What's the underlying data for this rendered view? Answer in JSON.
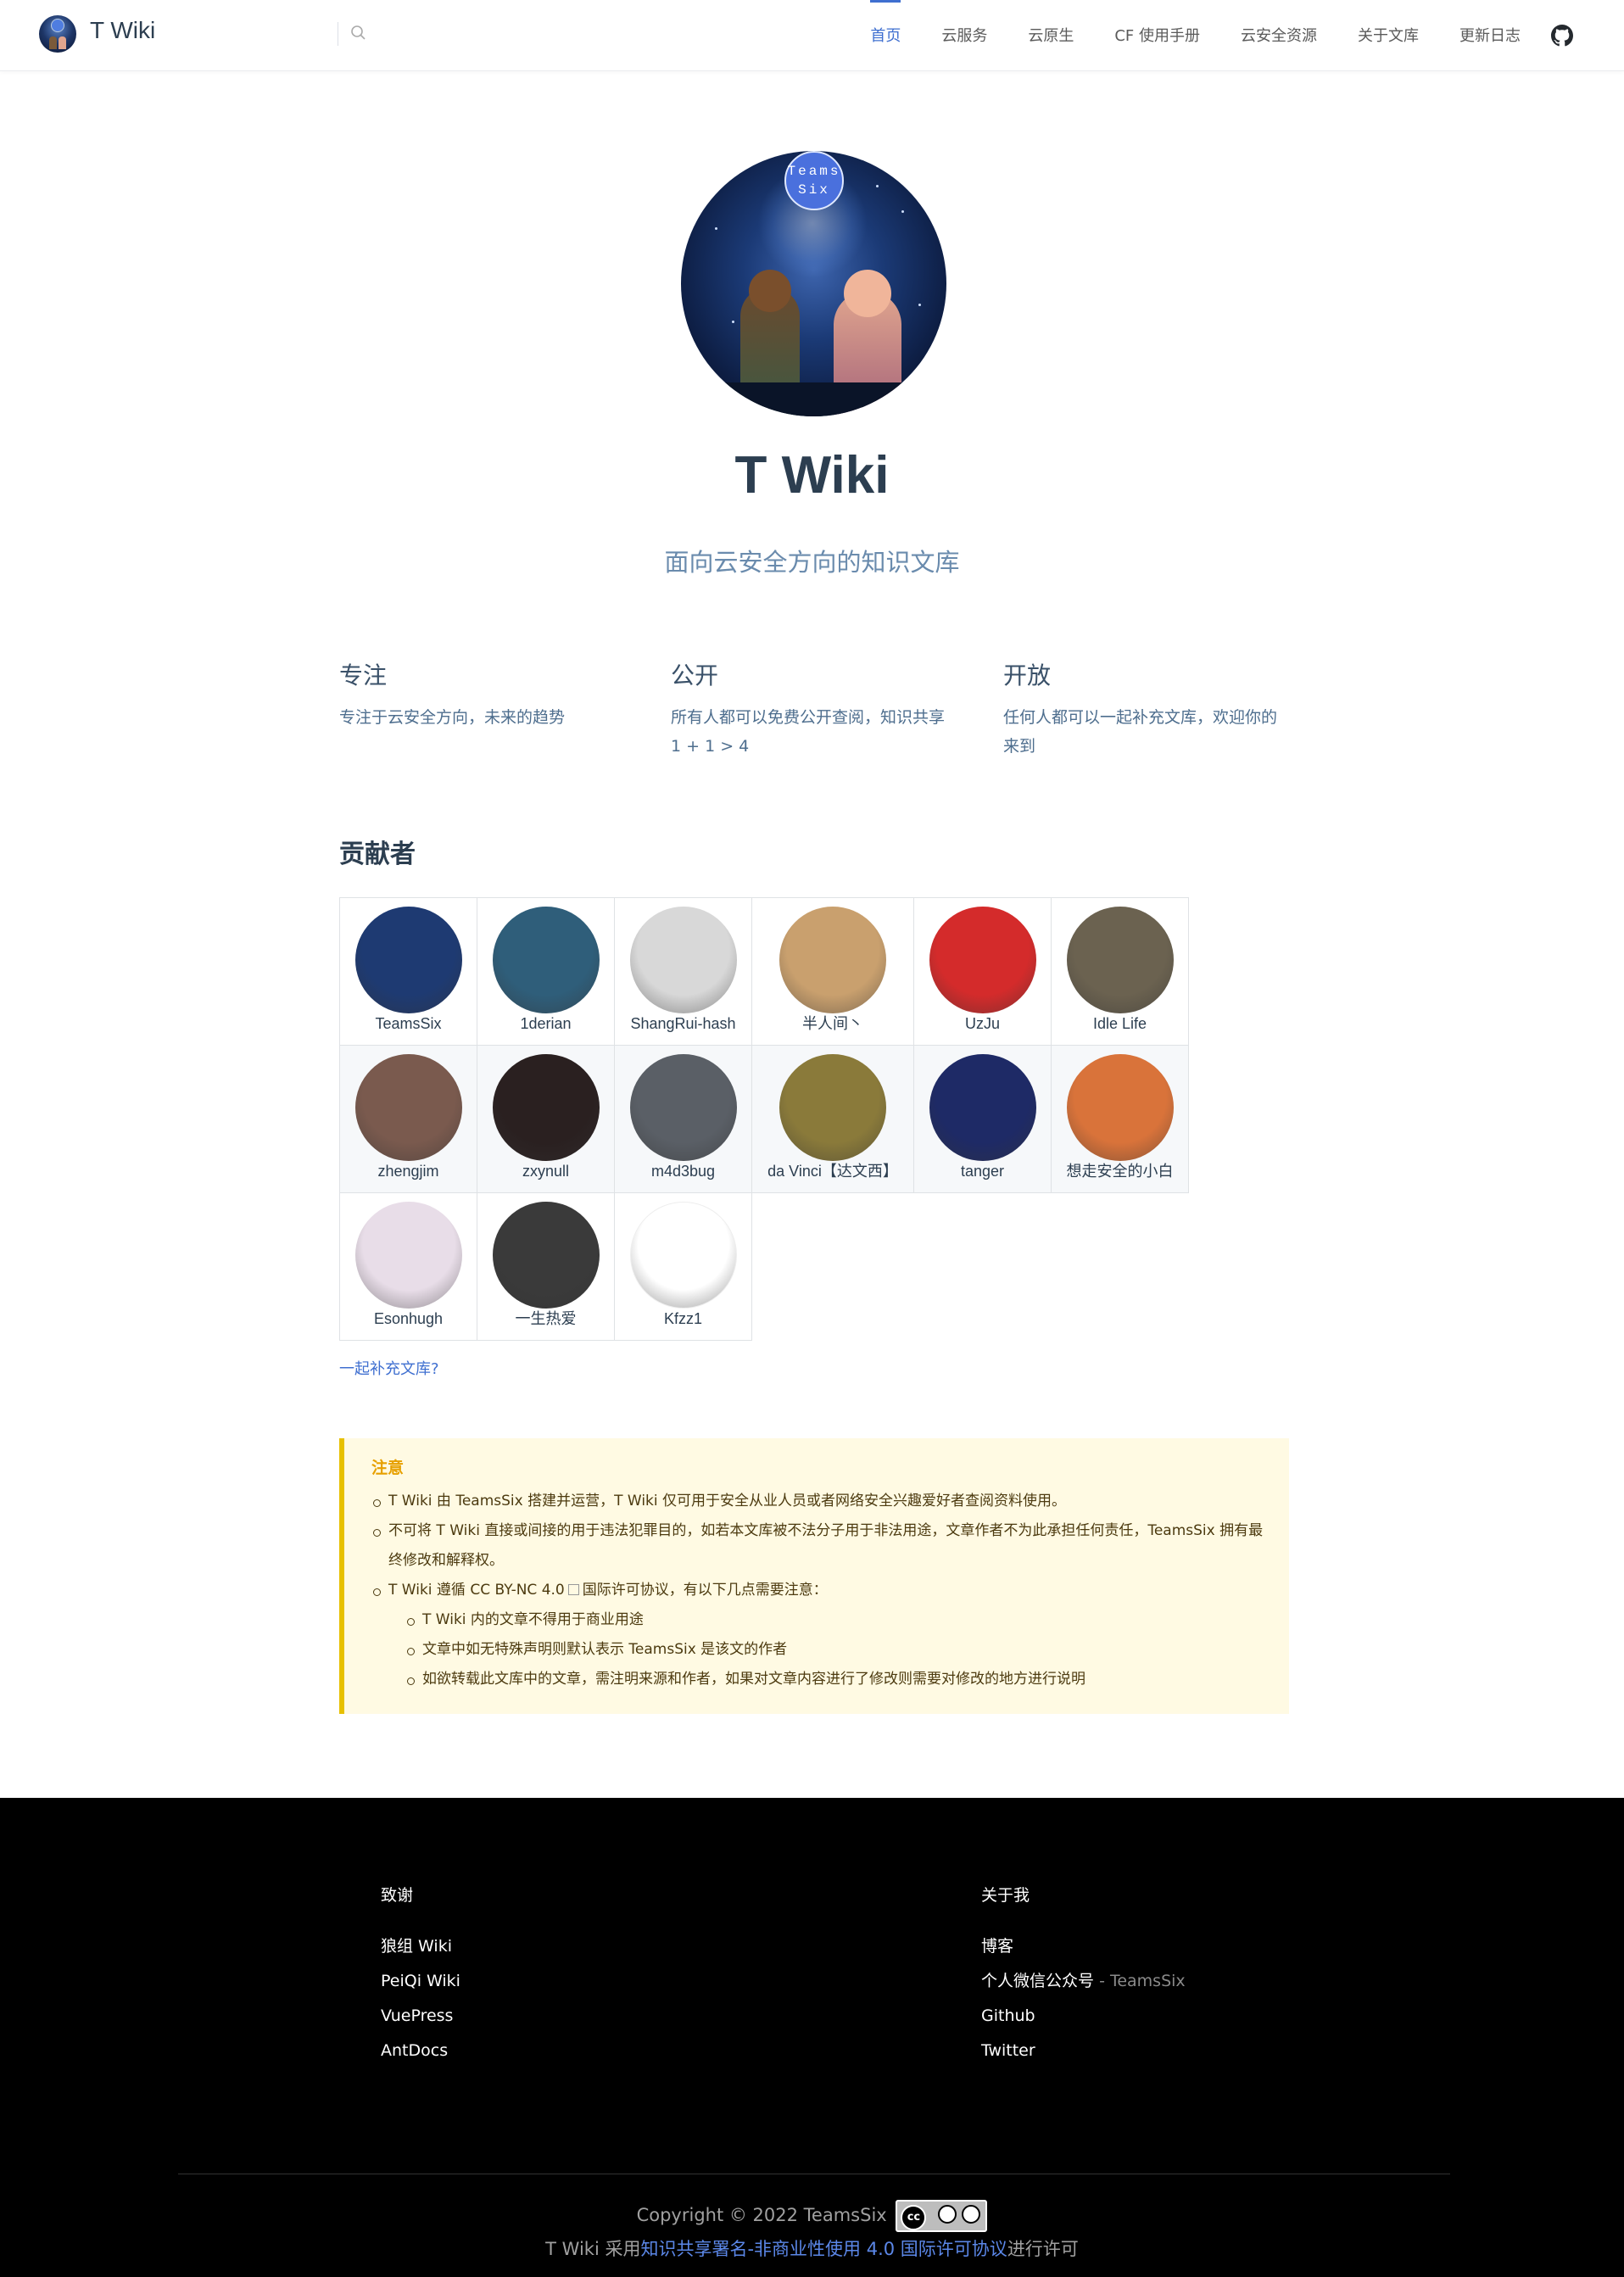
{
  "nav": {
    "site_name": "T Wiki",
    "items": [
      {
        "label": "首页",
        "active": true
      },
      {
        "label": "云服务",
        "active": false
      },
      {
        "label": "云原生",
        "active": false
      },
      {
        "label": "CF 使用手册",
        "active": false
      },
      {
        "label": "云安全资源",
        "active": false
      },
      {
        "label": "关于文库",
        "active": false
      },
      {
        "label": "更新日志",
        "active": false
      }
    ]
  },
  "hero": {
    "badge_line1": "Teams",
    "badge_line2": "Six",
    "title": "T Wiki",
    "description": "面向云安全方向的知识文库"
  },
  "features": [
    {
      "title": "专注",
      "text": "专注于云安全方向，未来的趋势"
    },
    {
      "title": "公开",
      "text": "所有人都可以免费公开查阅，知识共享 1 + 1 > 4"
    },
    {
      "title": "开放",
      "text": "任何人都可以一起补充文库，欢迎你的来到"
    }
  ],
  "contributors": {
    "title": "贡献者",
    "people": [
      {
        "name": "TeamsSix",
        "color": "#1e3a72"
      },
      {
        "name": "1derian",
        "color": "#2f5e7a"
      },
      {
        "name": "ShangRui-hash",
        "color": "#d8d8d8"
      },
      {
        "name": "半人间丶",
        "color": "#c9a06e"
      },
      {
        "name": "UzJu",
        "color": "#d42b2b"
      },
      {
        "name": "Idle Life",
        "color": "#6b6250"
      },
      {
        "name": "zhengjim",
        "color": "#7a5a4e"
      },
      {
        "name": "zxynull",
        "color": "#2a2020"
      },
      {
        "name": "m4d3bug",
        "color": "#5a5f66"
      },
      {
        "name": "da Vinci【达文西】",
        "color": "#8a7a3a"
      },
      {
        "name": "tanger",
        "color": "#1e2a66"
      },
      {
        "name": "想走安全的小白",
        "color": "#d9733a"
      },
      {
        "name": "Esonhugh",
        "color": "#e8dde8"
      },
      {
        "name": "一生热爱",
        "color": "#3a3a3a"
      },
      {
        "name": "Kfzz1",
        "color": "#ffffff"
      }
    ],
    "join_link": "一起补充文库?"
  },
  "warning": {
    "title": "注意",
    "items": [
      "T Wiki 由 TeamsSix 搭建并运营，T Wiki 仅可用于安全从业人员或者网络安全兴趣爱好者查阅资料使用。",
      "不可将 T Wiki 直接或间接的用于违法犯罪目的，如若本文库被不法分子用于非法用途，文章作者不为此承担任何责任，TeamsSix 拥有最终修改和解释权。",
      "T Wiki 遵循 CC BY-NC 4.0",
      "国际许可协议，有以下几点需要注意："
    ],
    "sub_items": [
      "T Wiki 内的文章不得用于商业用途",
      "文章中如无特殊声明则默认表示 TeamsSix 是该文的作者",
      "如欲转载此文库中的文章，需注明来源和作者，如果对文章内容进行了修改则需要对修改的地方进行说明"
    ]
  },
  "footer": {
    "col1_title": "致谢",
    "col1_links": [
      "狼组 Wiki",
      "PeiQi Wiki",
      "VuePress",
      "AntDocs"
    ],
    "col2_title": "关于我",
    "col2_links": [
      "博客",
      "个人微信公众号",
      "Github",
      "Twitter"
    ],
    "wechat_suffix": "- TeamsSix",
    "copyright": "Copyright © 2022 TeamsSix",
    "cc_label": "cc",
    "license_prefix": "T Wiki 采用",
    "license_link": "知识共享署名-非商业性使用 4.0 国际许可协议",
    "license_suffix": "进行许可"
  }
}
